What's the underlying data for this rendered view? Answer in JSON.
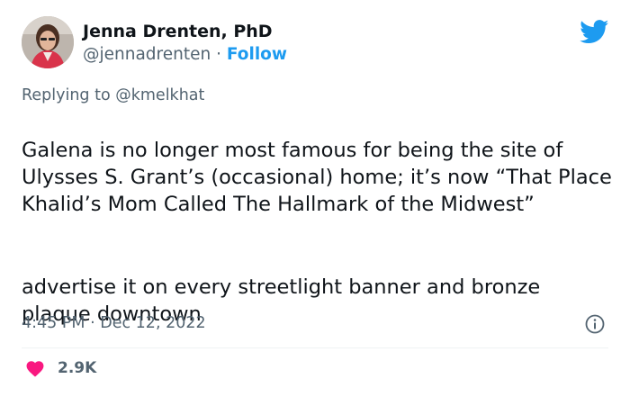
{
  "author": {
    "name": "Jenna Drenten, PhD",
    "handle": "@jennadrenten",
    "separator": "·",
    "follow_label": "Follow",
    "avatar_icon": "profile-photo"
  },
  "brand": {
    "icon": "twitter-bird-icon",
    "color": "#1d9bf0"
  },
  "reply": {
    "prefix": "Replying to",
    "handle": "@kmelkhat"
  },
  "tweet": {
    "paragraph_1": "Galena is no longer most famous for being the site of Ulysses S. Grant’s (occasional) home; it’s now “That Place Khalid’s Mom Called The Hallmark of the Midwest”",
    "paragraph_2": "advertise it on every streetlight banner and bronze plaque downtown"
  },
  "meta": {
    "time": "4:45 PM",
    "separator": "·",
    "date": "Dec 12, 2022",
    "info_icon": "info-icon"
  },
  "engagement": {
    "likes": "2.9K",
    "heart_color": "#f91880"
  }
}
